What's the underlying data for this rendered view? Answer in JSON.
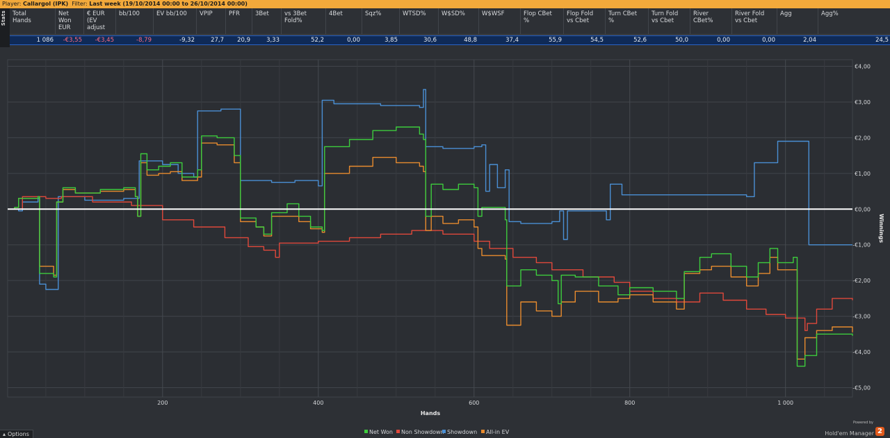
{
  "topbar": {
    "player_label": "Player:",
    "player_value": "Callargol (IPK)",
    "filter_label": "Filter:",
    "filter_value": "Last week (19/10/2014 00:00 to 26/10/2014 00:00)"
  },
  "stats_tab": "Stats",
  "stats": {
    "headers": [
      "Total\nHands",
      "Net\nWon\nEUR",
      "€ EUR\n(EV\nadjust",
      "bb/100",
      "EV bb/100",
      "VPIP",
      "PFR",
      "3Bet",
      "vs 3Bet\nFold%",
      "4Bet",
      "Sqz%",
      "WTSD%",
      "W$SD%",
      "W$WSF",
      "Flop CBet\n%",
      "Flop Fold\nvs Cbet",
      "Turn CBet\n%",
      "Turn Fold\nvs Cbet",
      "River\nCBet%",
      "River Fold\nvs Cbet",
      "Agg",
      "Agg%"
    ],
    "values": [
      "1 086",
      "-€3,55",
      "-€3,45",
      "-8,79",
      "-9,32",
      "27,7",
      "20,9",
      "3,33",
      "52,2",
      "0,00",
      "3,85",
      "30,6",
      "48,8",
      "37,4",
      "55,9",
      "54,5",
      "52,6",
      "50,0",
      "0,00",
      "0,00",
      "2,04",
      "24,5"
    ],
    "negative": [
      false,
      true,
      true,
      true,
      false,
      false,
      false,
      false,
      false,
      false,
      false,
      false,
      false,
      false,
      false,
      false,
      false,
      false,
      false,
      false,
      false,
      false
    ]
  },
  "chart_data": {
    "type": "line",
    "title": "",
    "xlabel": "Hands",
    "ylabel": "Winnings",
    "xlim": [
      1,
      1086
    ],
    "ylim": [
      -5.0,
      4.0
    ],
    "x_ticks": [
      200,
      400,
      600,
      800,
      1000
    ],
    "x_tick_labels": [
      "200",
      "400",
      "600",
      "800",
      "1 000"
    ],
    "y_ticks": [
      4,
      3,
      2,
      1,
      0,
      -1,
      -2,
      -3,
      -4,
      -5
    ],
    "y_tick_labels": [
      "€4,00",
      "€3,00",
      "€2,00",
      "€1,00",
      "€0,00",
      "-€1,00",
      "-€2,00",
      "-€3,00",
      "-€4,00",
      "-€5,00"
    ],
    "grid": true,
    "legend_position": "bottom-center",
    "series": [
      {
        "name": "Net Won",
        "color": "#3dcc3d",
        "points": [
          [
            1,
            0
          ],
          [
            10,
            0.05
          ],
          [
            15,
            0.3
          ],
          [
            40,
            0.35
          ],
          [
            42,
            -1.8
          ],
          [
            60,
            -1.9
          ],
          [
            64,
            0.2
          ],
          [
            72,
            0.6
          ],
          [
            88,
            0.45
          ],
          [
            120,
            0.55
          ],
          [
            150,
            0.6
          ],
          [
            165,
            0.35
          ],
          [
            168,
            -0.2
          ],
          [
            172,
            1.55
          ],
          [
            180,
            1.1
          ],
          [
            195,
            1.2
          ],
          [
            210,
            1.3
          ],
          [
            225,
            0.9
          ],
          [
            245,
            1.1
          ],
          [
            250,
            2.05
          ],
          [
            270,
            2.0
          ],
          [
            292,
            1.5
          ],
          [
            300,
            -0.25
          ],
          [
            320,
            -0.5
          ],
          [
            330,
            -0.7
          ],
          [
            340,
            -0.1
          ],
          [
            360,
            0.15
          ],
          [
            375,
            -0.2
          ],
          [
            390,
            -0.5
          ],
          [
            405,
            -0.6
          ],
          [
            408,
            1.75
          ],
          [
            440,
            1.95
          ],
          [
            470,
            2.2
          ],
          [
            500,
            2.3
          ],
          [
            530,
            2.1
          ],
          [
            535,
            1.95
          ],
          [
            538,
            -0.2
          ],
          [
            545,
            0.7
          ],
          [
            560,
            0.55
          ],
          [
            580,
            0.7
          ],
          [
            600,
            0.6
          ],
          [
            605,
            -0.2
          ],
          [
            610,
            0.05
          ],
          [
            625,
            0.05
          ],
          [
            640,
            -0.3
          ],
          [
            642,
            -2.15
          ],
          [
            660,
            -1.7
          ],
          [
            680,
            -1.85
          ],
          [
            700,
            -2.0
          ],
          [
            708,
            -2.65
          ],
          [
            712,
            -1.85
          ],
          [
            730,
            -1.9
          ],
          [
            760,
            -2.15
          ],
          [
            785,
            -2.4
          ],
          [
            800,
            -2.2
          ],
          [
            830,
            -2.3
          ],
          [
            860,
            -2.5
          ],
          [
            870,
            -1.75
          ],
          [
            890,
            -1.35
          ],
          [
            905,
            -1.25
          ],
          [
            930,
            -1.6
          ],
          [
            950,
            -1.9
          ],
          [
            965,
            -1.5
          ],
          [
            980,
            -1.1
          ],
          [
            990,
            -1.5
          ],
          [
            1010,
            -1.35
          ],
          [
            1015,
            -4.4
          ],
          [
            1025,
            -4.1
          ],
          [
            1040,
            -3.5
          ],
          [
            1060,
            -3.5
          ],
          [
            1086,
            -3.55
          ]
        ]
      },
      {
        "name": "Non Showdown",
        "color": "#e0483b",
        "points": [
          [
            1,
            0
          ],
          [
            20,
            0.35
          ],
          [
            50,
            0.3
          ],
          [
            70,
            0.35
          ],
          [
            110,
            0.2
          ],
          [
            160,
            0.1
          ],
          [
            200,
            -0.3
          ],
          [
            240,
            -0.5
          ],
          [
            280,
            -0.8
          ],
          [
            310,
            -1.05
          ],
          [
            330,
            -1.15
          ],
          [
            345,
            -1.35
          ],
          [
            350,
            -0.95
          ],
          [
            400,
            -0.9
          ],
          [
            440,
            -0.8
          ],
          [
            480,
            -0.7
          ],
          [
            520,
            -0.6
          ],
          [
            560,
            -0.7
          ],
          [
            600,
            -0.9
          ],
          [
            620,
            -1.1
          ],
          [
            650,
            -1.35
          ],
          [
            680,
            -1.5
          ],
          [
            700,
            -1.7
          ],
          [
            740,
            -1.9
          ],
          [
            780,
            -2.05
          ],
          [
            800,
            -2.3
          ],
          [
            830,
            -2.5
          ],
          [
            860,
            -2.6
          ],
          [
            890,
            -2.35
          ],
          [
            920,
            -2.55
          ],
          [
            950,
            -2.8
          ],
          [
            975,
            -2.95
          ],
          [
            1000,
            -3.05
          ],
          [
            1025,
            -3.4
          ],
          [
            1028,
            -3.2
          ],
          [
            1040,
            -2.8
          ],
          [
            1060,
            -2.5
          ],
          [
            1086,
            -2.55
          ]
        ]
      },
      {
        "name": "Showdown",
        "color": "#4a8fd4",
        "points": [
          [
            1,
            0
          ],
          [
            15,
            -0.05
          ],
          [
            20,
            0.2
          ],
          [
            40,
            0.3
          ],
          [
            42,
            -2.1
          ],
          [
            50,
            -2.25
          ],
          [
            64,
            -2.25
          ],
          [
            66,
            0.35
          ],
          [
            100,
            0.25
          ],
          [
            150,
            0.3
          ],
          [
            168,
            0.3
          ],
          [
            170,
            1.35
          ],
          [
            200,
            1.25
          ],
          [
            220,
            1.0
          ],
          [
            240,
            0.9
          ],
          [
            245,
            2.75
          ],
          [
            275,
            2.8
          ],
          [
            290,
            2.8
          ],
          [
            300,
            0.8
          ],
          [
            340,
            0.75
          ],
          [
            370,
            0.8
          ],
          [
            400,
            0.65
          ],
          [
            405,
            3.05
          ],
          [
            420,
            2.95
          ],
          [
            480,
            2.9
          ],
          [
            530,
            2.85
          ],
          [
            535,
            3.35
          ],
          [
            538,
            1.75
          ],
          [
            560,
            1.7
          ],
          [
            600,
            1.75
          ],
          [
            610,
            1.8
          ],
          [
            615,
            0.5
          ],
          [
            620,
            1.25
          ],
          [
            630,
            0.6
          ],
          [
            640,
            1.1
          ],
          [
            645,
            -0.35
          ],
          [
            660,
            -0.4
          ],
          [
            700,
            -0.35
          ],
          [
            710,
            -0.05
          ],
          [
            715,
            -0.85
          ],
          [
            720,
            -0.05
          ],
          [
            760,
            -0.05
          ],
          [
            770,
            -0.3
          ],
          [
            775,
            0.7
          ],
          [
            790,
            0.4
          ],
          [
            850,
            0.4
          ],
          [
            900,
            0.4
          ],
          [
            950,
            0.35
          ],
          [
            960,
            1.3
          ],
          [
            980,
            1.3
          ],
          [
            990,
            1.9
          ],
          [
            1020,
            1.9
          ],
          [
            1030,
            -1.0
          ],
          [
            1086,
            -1.0
          ]
        ]
      },
      {
        "name": "All-in EV",
        "color": "#e88b2e",
        "points": [
          [
            1,
            0
          ],
          [
            10,
            0.05
          ],
          [
            15,
            0.3
          ],
          [
            40,
            0.35
          ],
          [
            42,
            -1.6
          ],
          [
            60,
            -1.85
          ],
          [
            64,
            0.2
          ],
          [
            72,
            0.55
          ],
          [
            88,
            0.45
          ],
          [
            120,
            0.5
          ],
          [
            150,
            0.55
          ],
          [
            165,
            0.35
          ],
          [
            168,
            -0.2
          ],
          [
            172,
            1.3
          ],
          [
            180,
            0.95
          ],
          [
            195,
            1.0
          ],
          [
            210,
            1.05
          ],
          [
            225,
            0.8
          ],
          [
            245,
            0.9
          ],
          [
            250,
            1.85
          ],
          [
            270,
            1.8
          ],
          [
            292,
            1.3
          ],
          [
            300,
            -0.35
          ],
          [
            320,
            -0.5
          ],
          [
            330,
            -0.75
          ],
          [
            340,
            -0.2
          ],
          [
            360,
            -0.2
          ],
          [
            375,
            -0.35
          ],
          [
            390,
            -0.55
          ],
          [
            405,
            -0.65
          ],
          [
            408,
            1.0
          ],
          [
            440,
            1.2
          ],
          [
            470,
            1.45
          ],
          [
            500,
            1.3
          ],
          [
            530,
            1.2
          ],
          [
            535,
            1.05
          ],
          [
            538,
            -0.6
          ],
          [
            545,
            -0.2
          ],
          [
            560,
            -0.4
          ],
          [
            580,
            -0.3
          ],
          [
            600,
            -0.5
          ],
          [
            605,
            -1.1
          ],
          [
            610,
            -1.3
          ],
          [
            625,
            -1.3
          ],
          [
            640,
            -1.4
          ],
          [
            642,
            -3.25
          ],
          [
            660,
            -2.6
          ],
          [
            680,
            -2.85
          ],
          [
            700,
            -3.0
          ],
          [
            712,
            -2.6
          ],
          [
            730,
            -2.3
          ],
          [
            760,
            -2.6
          ],
          [
            785,
            -2.5
          ],
          [
            800,
            -2.4
          ],
          [
            830,
            -2.6
          ],
          [
            860,
            -2.8
          ],
          [
            870,
            -1.8
          ],
          [
            890,
            -1.7
          ],
          [
            905,
            -1.6
          ],
          [
            930,
            -1.9
          ],
          [
            950,
            -2.15
          ],
          [
            965,
            -1.8
          ],
          [
            980,
            -1.35
          ],
          [
            990,
            -1.7
          ],
          [
            1010,
            -1.7
          ],
          [
            1015,
            -4.2
          ],
          [
            1025,
            -3.6
          ],
          [
            1040,
            -3.4
          ],
          [
            1060,
            -3.3
          ],
          [
            1086,
            -3.45
          ]
        ]
      }
    ],
    "zero_line_color": "#ffffff"
  },
  "options_label": "Options",
  "brand": {
    "powered_by": "Powered by",
    "name": "Hold'em Manager",
    "badge": "2"
  }
}
